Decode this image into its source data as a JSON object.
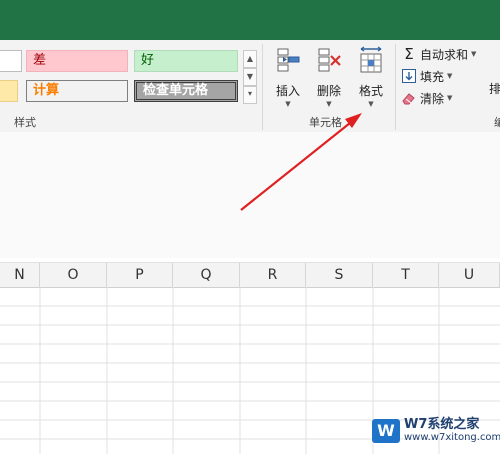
{
  "ribbon": {
    "styles": {
      "bad_label": "差",
      "good_label": "好",
      "calc_label": "计算",
      "check_cell_label": "检查单元格",
      "group_label": "样式"
    },
    "cells": {
      "insert_label": "插入",
      "delete_label": "删除",
      "format_label": "格式",
      "group_label": "单元格"
    },
    "editing": {
      "autosum_label": "自动求和",
      "fill_label": "填充",
      "clear_label": "清除",
      "sort_partial": "排",
      "group_partial": "编"
    }
  },
  "columns": [
    "N",
    "O",
    "P",
    "Q",
    "R",
    "S",
    "T",
    "U"
  ],
  "watermark": {
    "logo": "W",
    "title": "W7系统之家",
    "url": "www.w7xitong.com"
  },
  "colors": {
    "titlebar": "#217346",
    "bad_bg": "#ffc7ce",
    "bad_text": "#9c0006",
    "good_bg": "#c6efce",
    "good_text": "#006100",
    "calc_text": "#fa7d00",
    "check_bg": "#a5a5a5",
    "arrow": "#e02020"
  }
}
